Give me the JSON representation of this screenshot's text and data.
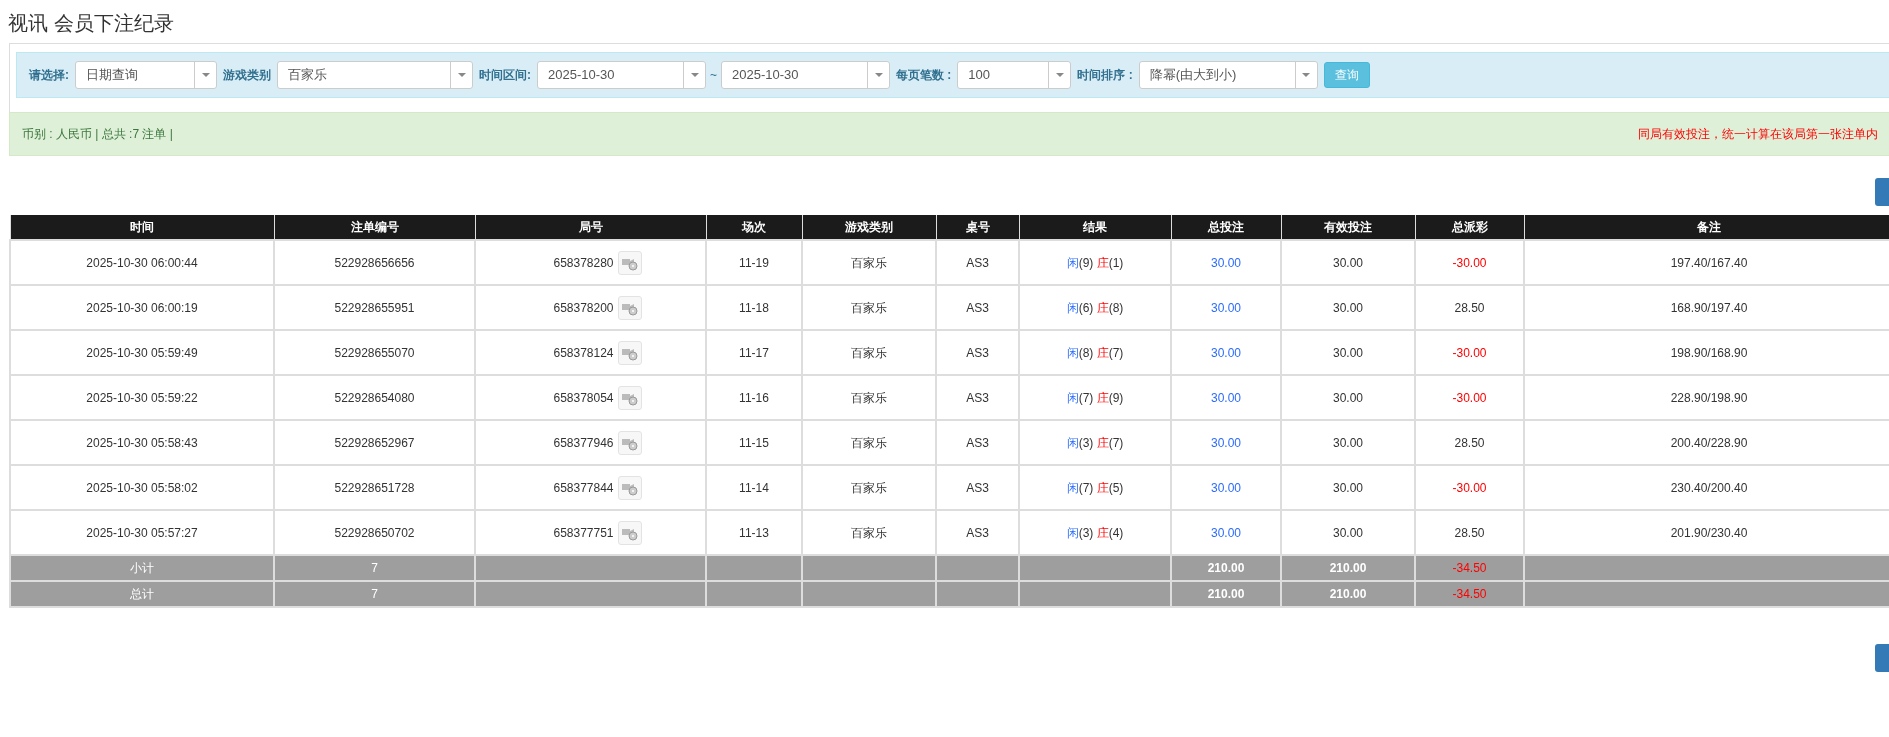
{
  "page_title": "视讯 会员下注纪录",
  "filters": [
    {
      "label": "请选择:",
      "value": "日期查询",
      "kind": "select"
    },
    {
      "label": "游戏类别",
      "value": "百家乐",
      "kind": "select"
    },
    {
      "label": "时间区间:",
      "value": "2025-10-30",
      "kind": "range",
      "separator": "~",
      "value_end": "2025-10-30"
    },
    {
      "label": "每页笔数 :",
      "value": "100",
      "kind": "select"
    },
    {
      "label": "时间排序 :",
      "value": "降幂(由大到小)",
      "kind": "select"
    }
  ],
  "query_button": "查询",
  "summary": "币别 : 人民币 | 总共 :7 注单 |",
  "notice": "同局有效投注，统一计算在该局第一张注单内",
  "table": {
    "columns": [
      "时间",
      "注单编号",
      "局号",
      "场次",
      "游戏类别",
      "桌号",
      "结果",
      "总投注",
      "有效投注",
      "总派彩",
      "备注"
    ],
    "rows": [
      {
        "time": "2025-10-30 06:00:44",
        "order_no": "522928656656",
        "round_no": "658378280",
        "session": "11-19",
        "game": "百家乐",
        "table_no": "AS3",
        "player": "闲",
        "player_points": "(9)",
        "banker": "庄",
        "banker_points": "(1)",
        "total_bet": "30.00",
        "valid_bet": "30.00",
        "payout": "-30.00",
        "payout_negative": true,
        "note": "197.40/167.40"
      },
      {
        "time": "2025-10-30 06:00:19",
        "order_no": "522928655951",
        "round_no": "658378200",
        "session": "11-18",
        "game": "百家乐",
        "table_no": "AS3",
        "player": "闲",
        "player_points": "(6)",
        "banker": "庄",
        "banker_points": "(8)",
        "total_bet": "30.00",
        "valid_bet": "30.00",
        "payout": "28.50",
        "payout_negative": false,
        "note": "168.90/197.40"
      },
      {
        "time": "2025-10-30 05:59:49",
        "order_no": "522928655070",
        "round_no": "658378124",
        "session": "11-17",
        "game": "百家乐",
        "table_no": "AS3",
        "player": "闲",
        "player_points": "(8)",
        "banker": "庄",
        "banker_points": "(7)",
        "total_bet": "30.00",
        "valid_bet": "30.00",
        "payout": "-30.00",
        "payout_negative": true,
        "note": "198.90/168.90"
      },
      {
        "time": "2025-10-30 05:59:22",
        "order_no": "522928654080",
        "round_no": "658378054",
        "session": "11-16",
        "game": "百家乐",
        "table_no": "AS3",
        "player": "闲",
        "player_points": "(7)",
        "banker": "庄",
        "banker_points": "(9)",
        "total_bet": "30.00",
        "valid_bet": "30.00",
        "payout": "-30.00",
        "payout_negative": true,
        "note": "228.90/198.90"
      },
      {
        "time": "2025-10-30 05:58:43",
        "order_no": "522928652967",
        "round_no": "658377946",
        "session": "11-15",
        "game": "百家乐",
        "table_no": "AS3",
        "player": "闲",
        "player_points": "(3)",
        "banker": "庄",
        "banker_points": "(7)",
        "total_bet": "30.00",
        "valid_bet": "30.00",
        "payout": "28.50",
        "payout_negative": false,
        "note": "200.40/228.90"
      },
      {
        "time": "2025-10-30 05:58:02",
        "order_no": "522928651728",
        "round_no": "658377844",
        "session": "11-14",
        "game": "百家乐",
        "table_no": "AS3",
        "player": "闲",
        "player_points": "(7)",
        "banker": "庄",
        "banker_points": "(5)",
        "total_bet": "30.00",
        "valid_bet": "30.00",
        "payout": "-30.00",
        "payout_negative": true,
        "note": "230.40/200.40"
      },
      {
        "time": "2025-10-30 05:57:27",
        "order_no": "522928650702",
        "round_no": "658377751",
        "session": "11-13",
        "game": "百家乐",
        "table_no": "AS3",
        "player": "闲",
        "player_points": "(3)",
        "banker": "庄",
        "banker_points": "(4)",
        "total_bet": "30.00",
        "valid_bet": "30.00",
        "payout": "28.50",
        "payout_negative": false,
        "note": "201.90/230.40"
      }
    ],
    "totals": [
      {
        "label": "小计",
        "count": "7",
        "total_bet": "210.00",
        "valid_bet": "210.00",
        "payout": "-34.50",
        "payout_negative": true
      },
      {
        "label": "总计",
        "count": "7",
        "total_bet": "210.00",
        "valid_bet": "210.00",
        "payout": "-34.50",
        "payout_negative": true
      }
    ]
  }
}
